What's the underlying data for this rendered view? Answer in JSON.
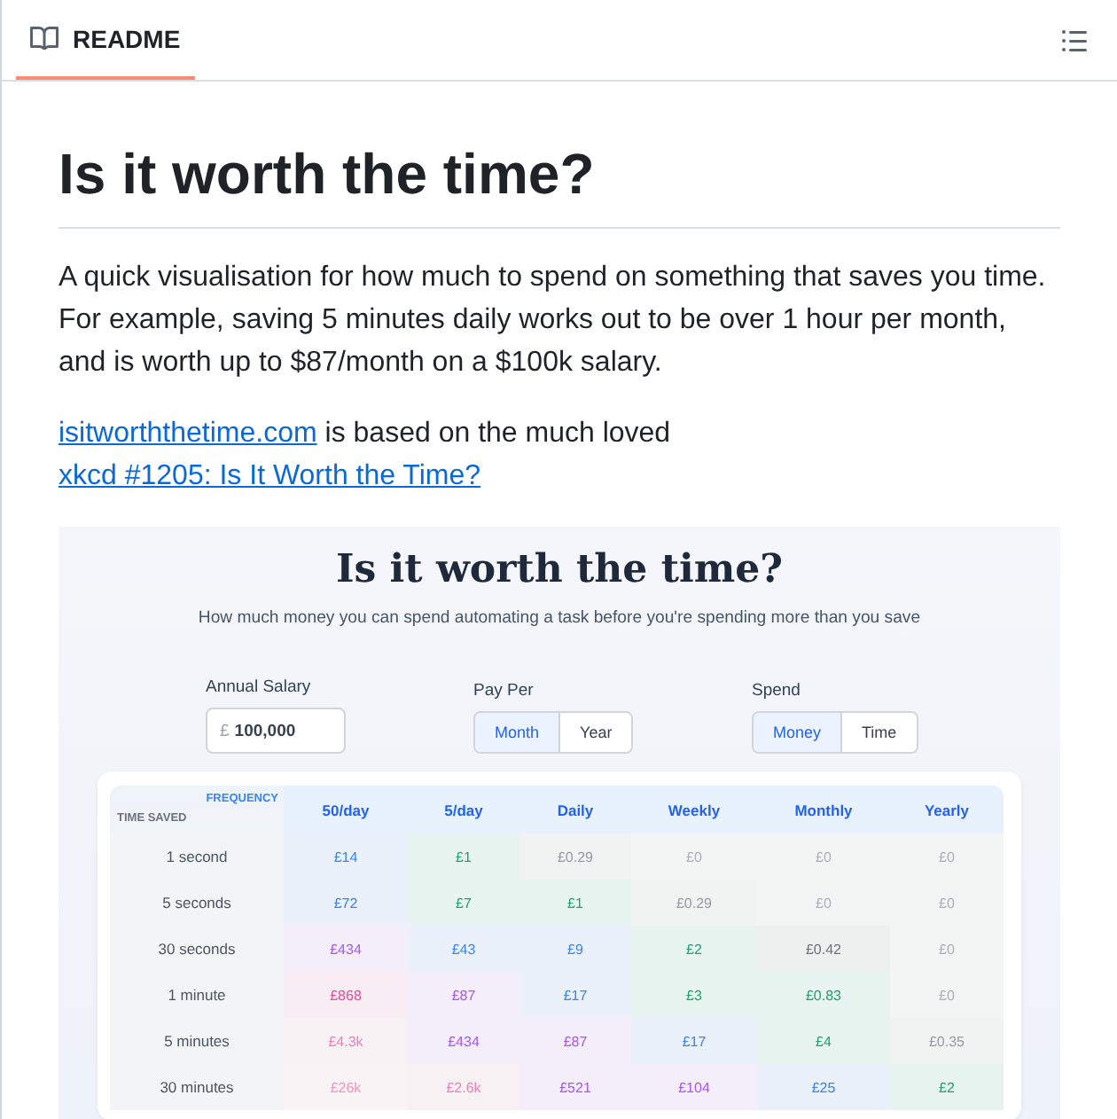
{
  "tab": {
    "label": "README",
    "selected": true
  },
  "readme": {
    "title": "Is it worth the time?",
    "paragraphs": [
      {
        "parts": [
          {
            "kind": "text",
            "text": "A quick visualisation for how much to spend on something that saves you time. For example, saving 5 minutes daily works out to be over 1 hour per month, and is worth up to $87/month on a $100k salary."
          }
        ]
      },
      {
        "parts": [
          {
            "kind": "link",
            "text": "isitworththetime.com"
          },
          {
            "kind": "text",
            "text": "is based on the much loved"
          },
          {
            "kind": "link",
            "text": "xkcd #1205: Is It Worth the Time?"
          }
        ]
      }
    ]
  },
  "preview": {
    "title": "Is it worth the time?",
    "subtitle": "How much money you can spend automating a task before you're spending more than you save",
    "controls": [
      {
        "kind": "input",
        "label": "Annual Salary",
        "prefix": "£",
        "value": "100,000"
      },
      {
        "kind": "toggle",
        "label": "Pay Per",
        "options": [
          {
            "label": "Month",
            "selected": true
          },
          {
            "label": "Year",
            "selected": false
          }
        ]
      },
      {
        "kind": "toggle",
        "label": "Spend",
        "options": [
          {
            "label": "Money",
            "selected": true
          },
          {
            "label": "Time",
            "selected": false
          }
        ]
      }
    ],
    "table": {
      "column_label": "FREQUENCY",
      "row_label": "TIME SAVED",
      "columns": [
        "50/day",
        "5/day",
        "Daily",
        "Weekly",
        "Monthly",
        "Yearly"
      ],
      "rows": [
        {
          "label": "1 second",
          "cells": [
            {
              "text": "£14",
              "color": "#3b82f6"
            },
            {
              "text": "£1",
              "color": "#22a06b"
            },
            {
              "text": "£0.29",
              "color": "#949ba7"
            },
            {
              "text": "£0",
              "color": "#aab0ba"
            },
            {
              "text": "£0",
              "color": "#aab0ba"
            },
            {
              "text": "£0",
              "color": "#aab0ba"
            }
          ]
        },
        {
          "label": "5 seconds",
          "cells": [
            {
              "text": "£72",
              "color": "#3b82f6"
            },
            {
              "text": "£7",
              "color": "#22a06b"
            },
            {
              "text": "£1",
              "color": "#22a06b"
            },
            {
              "text": "£0.29",
              "color": "#949ba7"
            },
            {
              "text": "£0",
              "color": "#aab0ba"
            },
            {
              "text": "£0",
              "color": "#aab0ba"
            }
          ]
        },
        {
          "label": "30 seconds",
          "cells": [
            {
              "text": "£434",
              "color": "#a855f7"
            },
            {
              "text": "£43",
              "color": "#3b82f6"
            },
            {
              "text": "£9",
              "color": "#3b82f6"
            },
            {
              "text": "£2",
              "color": "#22a06b"
            },
            {
              "text": "£0.42",
              "color": "#6b7280"
            },
            {
              "text": "£0",
              "color": "#aab0ba"
            }
          ]
        },
        {
          "label": "1 minute",
          "cells": [
            {
              "text": "£868",
              "color": "#ec4899"
            },
            {
              "text": "£87",
              "color": "#a855f7"
            },
            {
              "text": "£17",
              "color": "#3b82f6"
            },
            {
              "text": "£3",
              "color": "#22a06b"
            },
            {
              "text": "£0.83",
              "color": "#22a06b"
            },
            {
              "text": "£0",
              "color": "#aab0ba"
            }
          ]
        },
        {
          "label": "5 minutes",
          "cells": [
            {
              "text": "£4.3k",
              "color": "#f07db5"
            },
            {
              "text": "£434",
              "color": "#a855f7"
            },
            {
              "text": "£87",
              "color": "#a855f7"
            },
            {
              "text": "£17",
              "color": "#3b82f6"
            },
            {
              "text": "£4",
              "color": "#22a06b"
            },
            {
              "text": "£0.35",
              "color": "#949ba7"
            }
          ]
        },
        {
          "label": "30 minutes",
          "cells": [
            {
              "text": "£26k",
              "color": "#f493c2"
            },
            {
              "text": "£2.6k",
              "color": "#f07db5"
            },
            {
              "text": "£521",
              "color": "#a855f7"
            },
            {
              "text": "£104",
              "color": "#a855f7"
            },
            {
              "text": "£25",
              "color": "#3b82f6"
            },
            {
              "text": "£2",
              "color": "#22a06b"
            }
          ]
        }
      ]
    }
  }
}
